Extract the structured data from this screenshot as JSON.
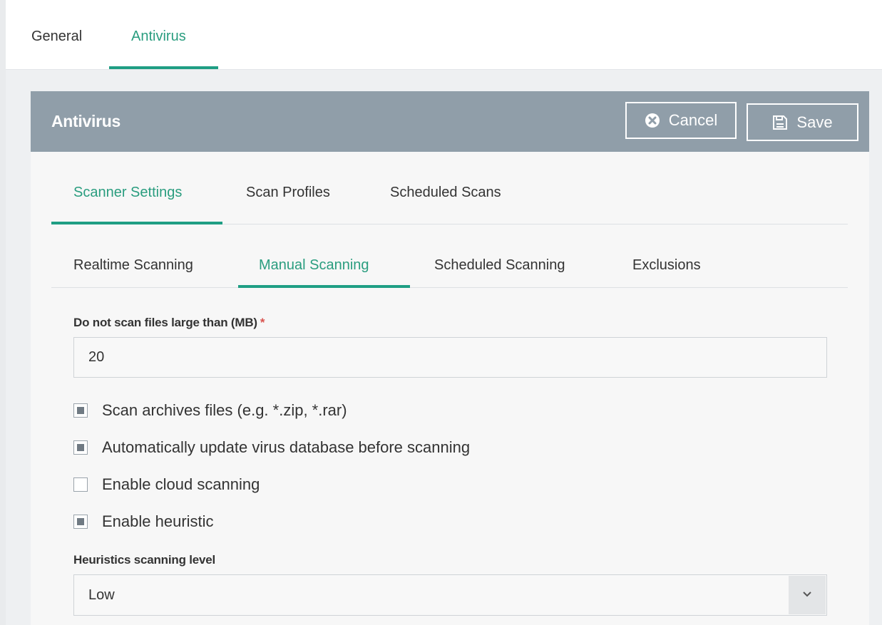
{
  "top_tabs": {
    "general": "General",
    "antivirus": "Antivirus"
  },
  "panel": {
    "title": "Antivirus",
    "cancel_label": "Cancel",
    "save_label": "Save"
  },
  "settings_tabs": {
    "scanner_settings": "Scanner Settings",
    "scan_profiles": "Scan Profiles",
    "scheduled_scans": "Scheduled Scans"
  },
  "scanning_tabs": {
    "realtime": "Realtime Scanning",
    "manual": "Manual Scanning",
    "scheduled": "Scheduled Scanning",
    "exclusions": "Exclusions"
  },
  "form": {
    "max_size_label": "Do not scan files large than (MB)",
    "required_mark": "*",
    "max_size_value": "20",
    "checkboxes": [
      {
        "label": "Scan archives files (e.g. *.zip, *.rar)",
        "checked": true
      },
      {
        "label": "Automatically update virus database before scanning",
        "checked": true
      },
      {
        "label": "Enable cloud scanning",
        "checked": false
      },
      {
        "label": "Enable heuristic",
        "checked": true
      }
    ],
    "heuristics_label": "Heuristics scanning level",
    "heuristics_value": "Low"
  },
  "colors": {
    "accent": "#1f9e84",
    "header_bg": "#909ea9"
  },
  "icons": {
    "cancel": "close-circle-icon",
    "save": "floppy-disk-icon",
    "dropdown": "chevron-down-icon"
  }
}
